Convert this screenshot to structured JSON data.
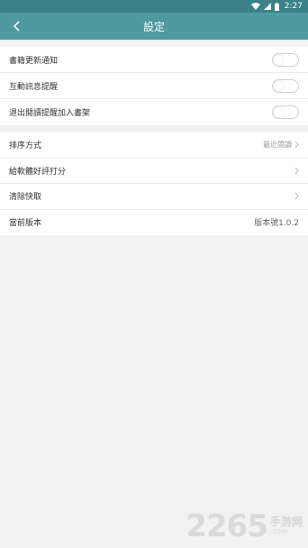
{
  "status_bar": {
    "time": "2:27"
  },
  "header": {
    "title": "設定"
  },
  "toggles": [
    {
      "label": "書籍更新通知",
      "on": false
    },
    {
      "label": "互動訊息提醒",
      "on": false
    },
    {
      "label": "退出閱讀提醒加入書架",
      "on": false
    }
  ],
  "settings": {
    "sort": {
      "label": "排序方式",
      "value": "最近閱讀"
    },
    "rate": {
      "label": "給軟體好評打分"
    },
    "clear": {
      "label": "清除快取"
    },
    "version": {
      "label": "當前版本",
      "value": "版本號1.0.2"
    }
  },
  "watermark": {
    "number": "2265",
    "cn": "手游网",
    "com": ".com"
  },
  "colors": {
    "status_bar": "#3a8289",
    "app_bar": "#4e9aa0",
    "background": "#f2f2f2"
  }
}
